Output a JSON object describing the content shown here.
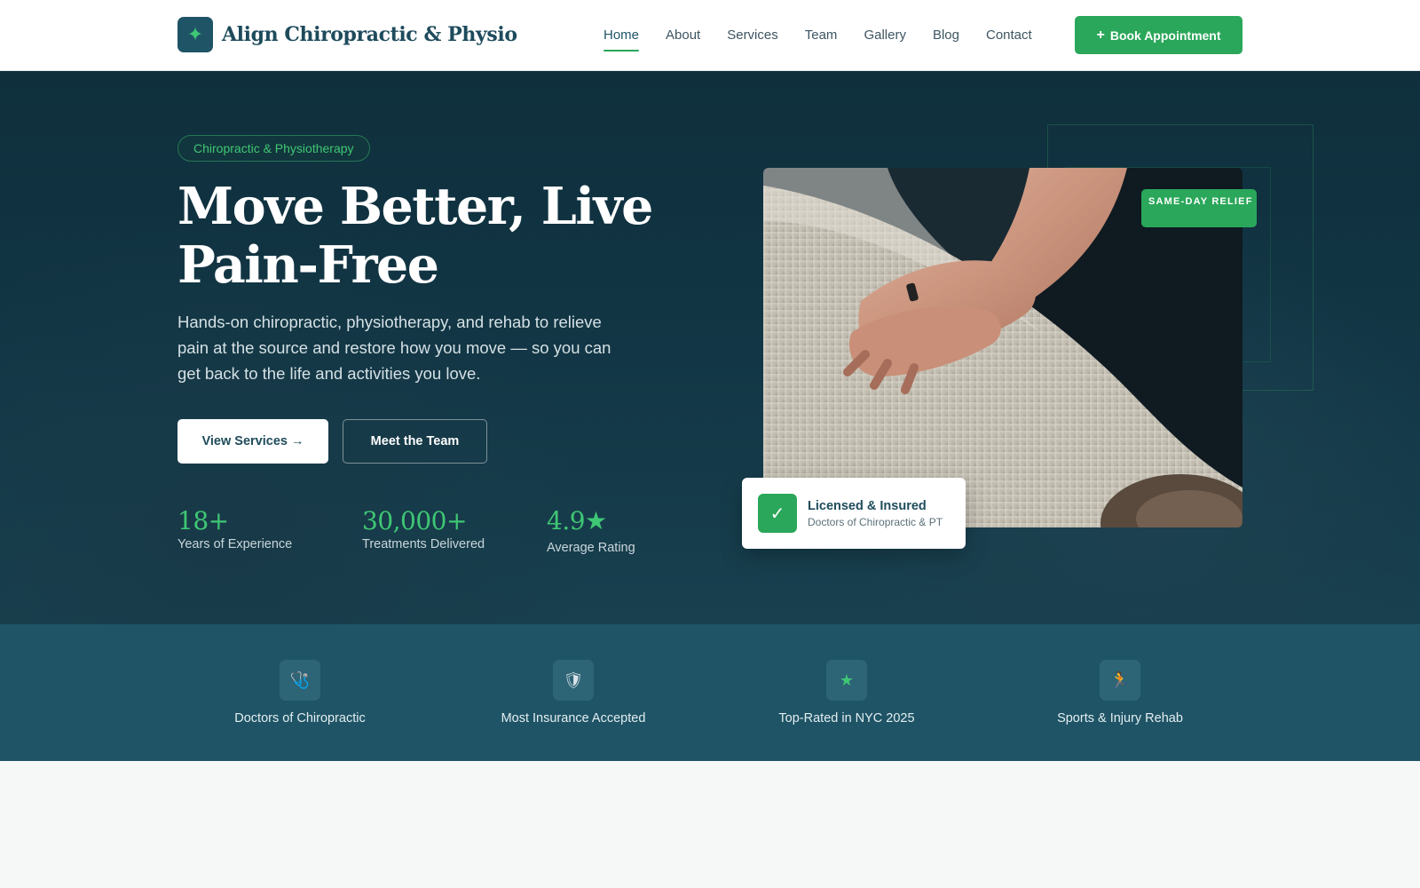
{
  "brand": {
    "name": "Align Chiropractic & Physio",
    "logo_glyph": "✦"
  },
  "nav": {
    "links": [
      "Home",
      "About",
      "Services",
      "Team",
      "Gallery",
      "Blog",
      "Contact"
    ],
    "active": "Home",
    "cta_icon": "+",
    "cta_label": "Book Appointment"
  },
  "hero": {
    "tag": "Chiropractic & Physiotherapy",
    "title": "Move Better, Live Pain-Free",
    "subtitle": "Hands-on chiropractic, physiotherapy, and rehab to relieve pain at the source and restore how you move — so you can get back to the life and activities you love.",
    "primary_button": "View Services →",
    "secondary_button": "Meet the Team",
    "stats": [
      {
        "value": "18+",
        "label": "Years of Experience"
      },
      {
        "value": "30,000+",
        "label": "Treatments Delivered"
      },
      {
        "value": "4.9★",
        "label": "Average Rating"
      }
    ],
    "image_badge": "SAME-DAY RELIEF",
    "credential_card": {
      "icon": "check-icon",
      "title": "Licensed & Insured",
      "subtitle": "Doctors of Chiropractic & PT"
    }
  },
  "features": [
    {
      "icon": "stethoscope-icon",
      "glyph": "🩺",
      "label": "Doctors of Chiropractic"
    },
    {
      "icon": "shield-icon",
      "glyph": "🛡",
      "label": "Most Insurance Accepted"
    },
    {
      "icon": "star-icon",
      "glyph": "★",
      "label": "Top-Rated in NYC 2025"
    },
    {
      "icon": "runner-icon",
      "glyph": "🏃",
      "label": "Sports & Injury Rehab"
    }
  ],
  "colors": {
    "accent": "#2aa75a",
    "navy": "#1f5466",
    "hero_bg": "#123645"
  }
}
